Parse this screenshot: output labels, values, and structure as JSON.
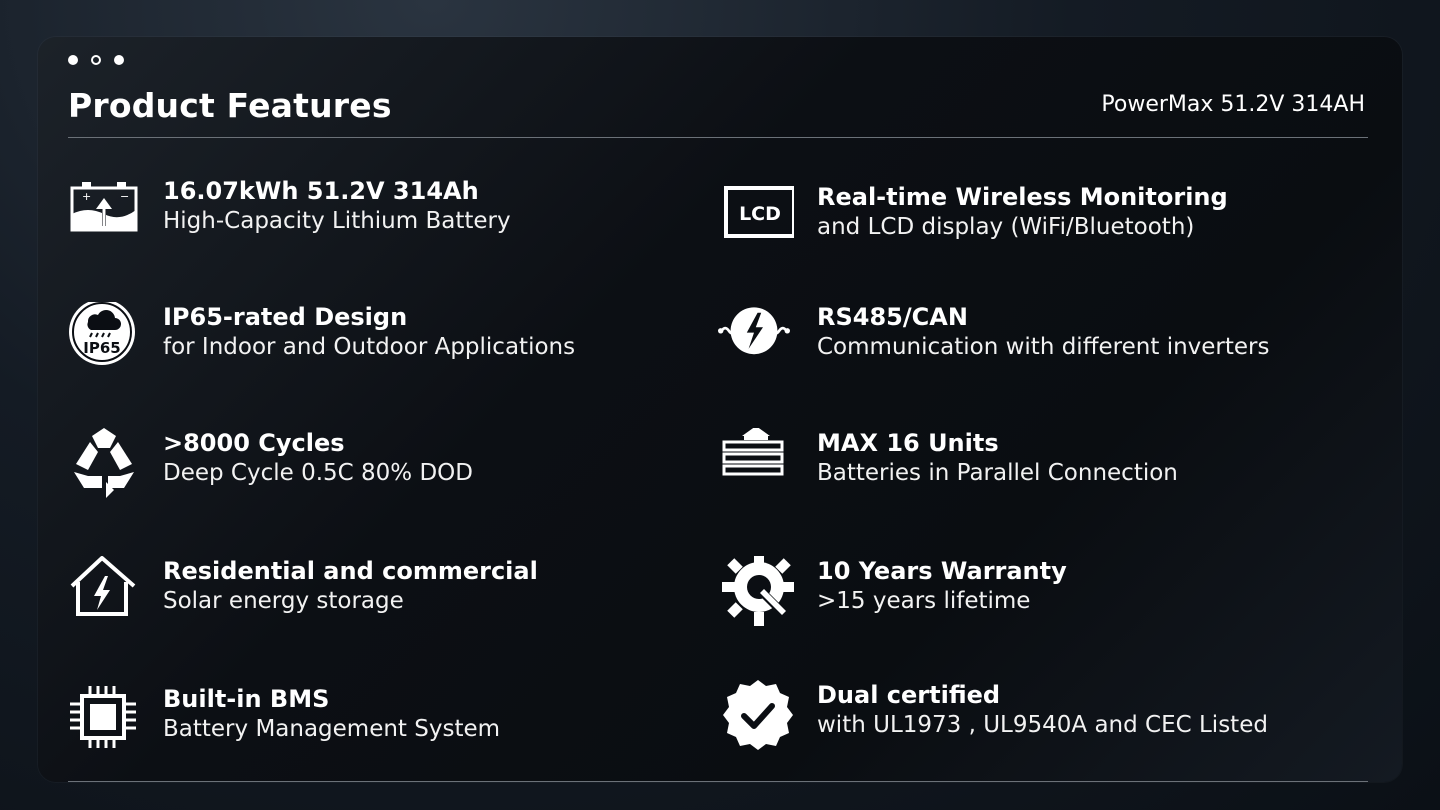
{
  "header": {
    "title": "Product Features",
    "product_name": "PowerMax 51.2V 314AH"
  },
  "window_dots": [
    "filled",
    "hollow",
    "filled"
  ],
  "features": [
    {
      "icon": "battery-icon",
      "title": "16.07kWh 51.2V 314Ah",
      "description": "High-Capacity Lithium Battery"
    },
    {
      "icon": "lcd-icon",
      "title": "Real-time Wireless Monitoring",
      "description": "and LCD display (WiFi/Bluetooth)",
      "icon_text": "LCD"
    },
    {
      "icon": "ip65-icon",
      "title": "IP65-rated Design",
      "description": "for Indoor and Outdoor Applications",
      "icon_text": "IP65"
    },
    {
      "icon": "communication-icon",
      "title": "RS485/CAN",
      "description": "Communication with different inverters"
    },
    {
      "icon": "recycle-icon",
      "title": ">8000 Cycles",
      "description": "Deep Cycle 0.5C 80% DOD"
    },
    {
      "icon": "stack-icon",
      "title": "MAX 16 Units",
      "description": "Batteries in Parallel Connection"
    },
    {
      "icon": "home-energy-icon",
      "title": "Residential and commercial",
      "description": "Solar energy storage"
    },
    {
      "icon": "gear-wrench-icon",
      "title": "10 Years Warranty",
      "description": ">15 years lifetime"
    },
    {
      "icon": "chip-icon",
      "title": "Built-in BMS",
      "description": "Battery Management System"
    },
    {
      "icon": "certified-badge-icon",
      "title": "Dual certified",
      "description": "with UL1973 , UL9540A and CEC Listed"
    }
  ]
}
